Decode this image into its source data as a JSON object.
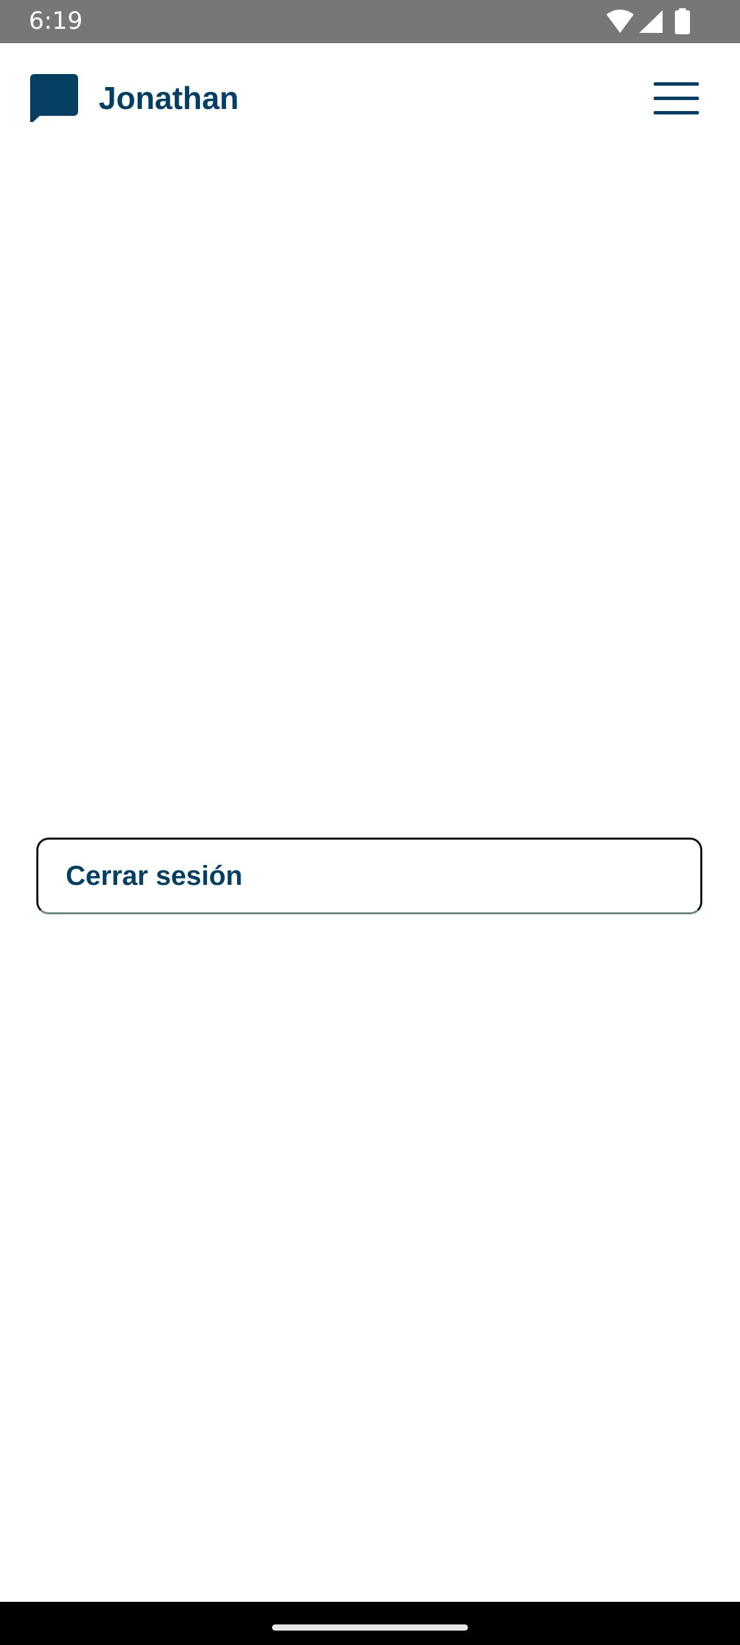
{
  "status_bar": {
    "time": "6:19",
    "icons": [
      "wifi-icon",
      "cell-signal-icon",
      "battery-icon"
    ]
  },
  "app_bar": {
    "title": "Jonathan",
    "logo_icon": "chat-bubble-icon",
    "menu_icon": "hamburger-menu-icon"
  },
  "main": {
    "logout_label": "Cerrar sesión"
  },
  "colors": {
    "brand": "#073f62",
    "status_bar": "#777777",
    "nav_bar": "#000000",
    "background": "#ffffff"
  }
}
